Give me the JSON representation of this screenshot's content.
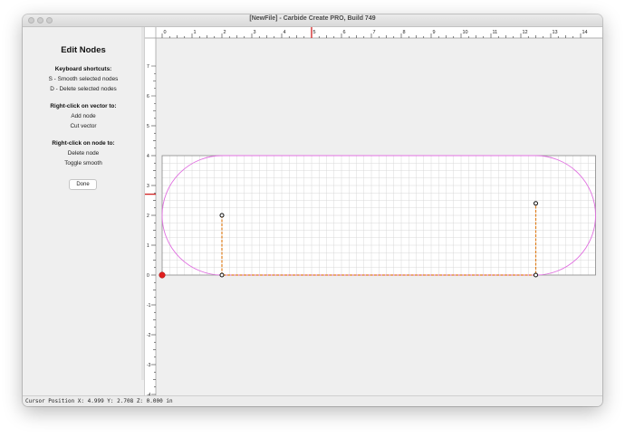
{
  "window": {
    "title": "[NewFile] - Carbide Create PRO, Build 749"
  },
  "sidebar": {
    "heading": "Edit Nodes",
    "keyboard_heading": "Keyboard shortcuts:",
    "keyboard_items": [
      "S - Smooth selected nodes",
      "D - Delete selected nodes"
    ],
    "vector_heading": "Right-click on vector to:",
    "vector_items": [
      "Add node",
      "Cut vector"
    ],
    "node_heading": "Right-click on node to:",
    "node_items": [
      "Delete node",
      "Toggle smooth"
    ],
    "done_label": "Done"
  },
  "ruler": {
    "x_labels": [
      "0",
      "1",
      "2",
      "3",
      "4",
      "5",
      "6",
      "7",
      "8",
      "9",
      "10",
      "11",
      "12",
      "13",
      "14"
    ],
    "y_labels": [
      "7",
      "6",
      "5",
      "4",
      "3",
      "2",
      "1",
      "0",
      "-1",
      "-2",
      "-3",
      "-4"
    ]
  },
  "status": {
    "cursor": "Cursor Position X: 4.999 Y: 2.708 Z: 0.000 in"
  },
  "colors": {
    "stock_outline": "#888888",
    "grid": "#d8d8d8",
    "vector": "#e070e0",
    "selected_path": "#e08020",
    "ruler_marker": "#d02020",
    "origin": "#e02020"
  }
}
